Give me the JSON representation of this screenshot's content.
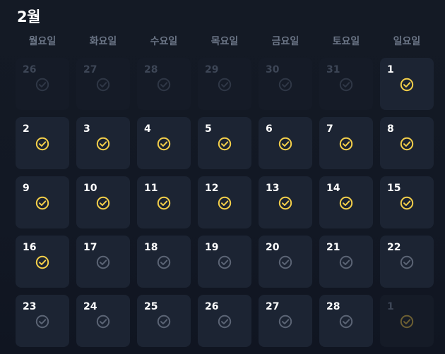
{
  "calendar": {
    "title": "2월",
    "weekdays": [
      "월요일",
      "화요일",
      "수요일",
      "목요일",
      "금요일",
      "토요일",
      "일요일"
    ],
    "colors": {
      "done": "#f5d04a",
      "pending": "#5b6475",
      "cell_bg": "#1c2433",
      "outside_bg": "#151b27"
    },
    "rows": [
      [
        {
          "day": "26",
          "status": "faded",
          "outside": true
        },
        {
          "day": "27",
          "status": "faded",
          "outside": true
        },
        {
          "day": "28",
          "status": "faded",
          "outside": true
        },
        {
          "day": "29",
          "status": "faded",
          "outside": true
        },
        {
          "day": "30",
          "status": "faded",
          "outside": true
        },
        {
          "day": "31",
          "status": "faded",
          "outside": true
        },
        {
          "day": "1",
          "status": "done",
          "outside": false
        }
      ],
      [
        {
          "day": "2",
          "status": "done",
          "outside": false
        },
        {
          "day": "3",
          "status": "done",
          "outside": false
        },
        {
          "day": "4",
          "status": "done",
          "outside": false
        },
        {
          "day": "5",
          "status": "done",
          "outside": false
        },
        {
          "day": "6",
          "status": "done",
          "outside": false
        },
        {
          "day": "7",
          "status": "done",
          "outside": false
        },
        {
          "day": "8",
          "status": "done",
          "outside": false
        }
      ],
      [
        {
          "day": "9",
          "status": "done",
          "outside": false
        },
        {
          "day": "10",
          "status": "done",
          "outside": false
        },
        {
          "day": "11",
          "status": "done",
          "outside": false
        },
        {
          "day": "12",
          "status": "done",
          "outside": false
        },
        {
          "day": "13",
          "status": "done",
          "outside": false
        },
        {
          "day": "14",
          "status": "done",
          "outside": false
        },
        {
          "day": "15",
          "status": "done",
          "outside": false
        }
      ],
      [
        {
          "day": "16",
          "status": "done",
          "outside": false
        },
        {
          "day": "17",
          "status": "pending",
          "outside": false
        },
        {
          "day": "18",
          "status": "pending",
          "outside": false
        },
        {
          "day": "19",
          "status": "pending",
          "outside": false
        },
        {
          "day": "20",
          "status": "pending",
          "outside": false
        },
        {
          "day": "21",
          "status": "pending",
          "outside": false
        },
        {
          "day": "22",
          "status": "pending",
          "outside": false
        }
      ],
      [
        {
          "day": "23",
          "status": "pending",
          "outside": false
        },
        {
          "day": "24",
          "status": "pending",
          "outside": false
        },
        {
          "day": "25",
          "status": "pending",
          "outside": false
        },
        {
          "day": "26",
          "status": "pending",
          "outside": false
        },
        {
          "day": "27",
          "status": "pending",
          "outside": false
        },
        {
          "day": "28",
          "status": "pending",
          "outside": false
        },
        {
          "day": "1",
          "status": "faded-gold",
          "outside": true
        }
      ]
    ]
  }
}
